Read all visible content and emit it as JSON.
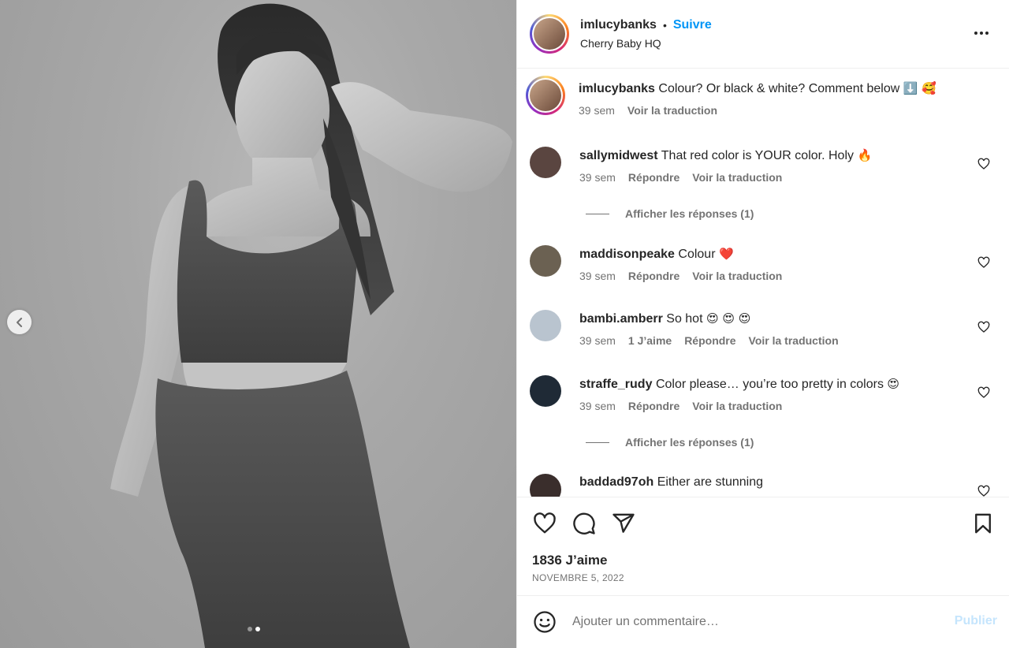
{
  "post": {
    "username": "imlucybanks",
    "separator": "•",
    "follow_label": "Suivre",
    "location": "Cherry Baby HQ",
    "more_icon": "more-horizontal-icon"
  },
  "caption": {
    "username": "imlucybanks",
    "text": "Colour? Or black & white? Comment below",
    "emoji": "⬇️ 🥰",
    "time": "39 sem",
    "translate_label": "Voir la traduction"
  },
  "comments": [
    {
      "username": "sallymidwest",
      "text": "That red color is YOUR color. Holy",
      "emoji": "🔥",
      "time": "39 sem",
      "likes": "",
      "reply_label": "Répondre",
      "translate_label": "Voir la traduction",
      "replies_label": "Afficher les réponses (1)",
      "avatar_color": "#5a4540"
    },
    {
      "username": "maddisonpeake",
      "text": "Colour",
      "emoji": "❤️",
      "time": "39 sem",
      "likes": "",
      "reply_label": "Répondre",
      "translate_label": "Voir la traduction",
      "replies_label": "",
      "avatar_color": "#6b6152"
    },
    {
      "username": "bambi.amberr",
      "text": "So hot",
      "emoji": "😍 😍 😍",
      "time": "39 sem",
      "likes": "1 J’aime",
      "reply_label": "Répondre",
      "translate_label": "Voir la traduction",
      "replies_label": "",
      "avatar_color": "#b9c4cf"
    },
    {
      "username": "straffe_rudy",
      "text": "Color please… you’re too pretty in colors",
      "emoji": "😍",
      "time": "39 sem",
      "likes": "",
      "reply_label": "Répondre",
      "translate_label": "Voir la traduction",
      "replies_label": "Afficher les réponses (1)",
      "avatar_color": "#1f2a36"
    },
    {
      "username": "baddad97oh",
      "text": "Either are stunning",
      "emoji": "",
      "time": "",
      "likes": "",
      "reply_label": "",
      "translate_label": "",
      "replies_label": "",
      "avatar_color": "#3a2e2c"
    }
  ],
  "stats": {
    "likes": "1836 J’aime",
    "date": "NOVEMBRE 5, 2022"
  },
  "composer": {
    "placeholder": "Ajouter un commentaire…",
    "publish_label": "Publier"
  },
  "carousel": {
    "slide_count": 2,
    "active_slide": 2
  },
  "colors": {
    "accent": "#0095f6",
    "publish_disabled": "#c5e5fd",
    "muted": "#737373",
    "text": "#262626"
  }
}
